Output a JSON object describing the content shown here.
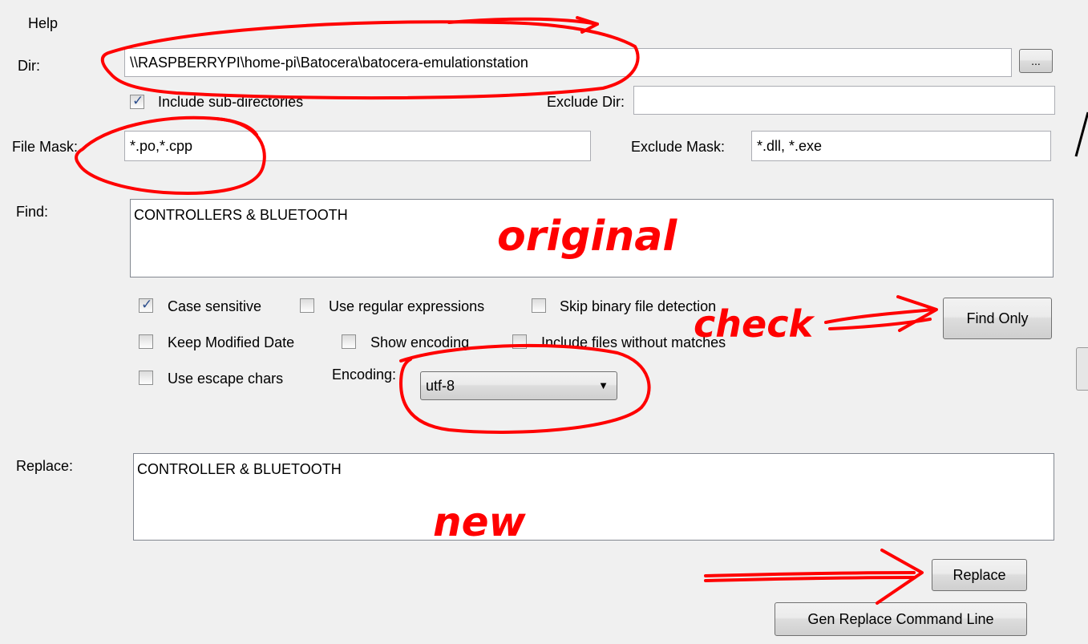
{
  "menu": {
    "help": "Help"
  },
  "dir": {
    "label": "Dir:",
    "value": "\\\\RASPBERRYPI\\home-pi\\Batocera\\batocera-emulationstation",
    "browse": "..."
  },
  "subdirs": {
    "label": "Include sub-directories",
    "checked": true
  },
  "exclude_dir": {
    "label": "Exclude Dir:",
    "value": ""
  },
  "file_mask": {
    "label": "File Mask:",
    "value": "*.po,*.cpp"
  },
  "exclude_mask": {
    "label": "Exclude Mask:",
    "value": "*.dll, *.exe"
  },
  "find": {
    "label": "Find:",
    "value": "CONTROLLERS & BLUETOOTH"
  },
  "options": {
    "case_sensitive": {
      "label": "Case sensitive",
      "checked": true
    },
    "regex": {
      "label": "Use regular expressions",
      "checked": false
    },
    "skip_binary": {
      "label": "Skip binary file detection",
      "checked": false
    },
    "keep_date": {
      "label": "Keep Modified Date",
      "checked": false
    },
    "show_encoding": {
      "label": "Show encoding",
      "checked": false
    },
    "include_no_match": {
      "label": "Include files without matches",
      "checked": false
    },
    "escape_chars": {
      "label": "Use escape chars",
      "checked": false
    }
  },
  "encoding": {
    "label": "Encoding:",
    "value": "utf-8"
  },
  "buttons": {
    "find_only": "Find Only",
    "replace": "Replace",
    "gen_cmd": "Gen Replace Command Line"
  },
  "replace": {
    "label": "Replace:",
    "value": "CONTROLLER & BLUETOOTH"
  },
  "annotations": {
    "original": "original",
    "check": "check",
    "new": "new",
    "color": "#ff0000"
  }
}
